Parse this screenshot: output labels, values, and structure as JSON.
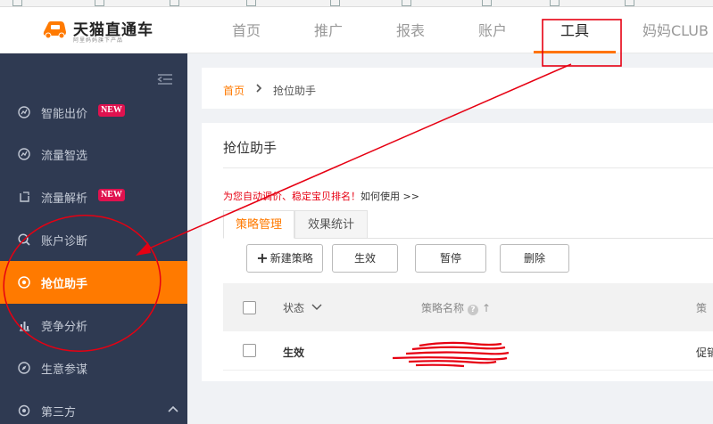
{
  "header": {
    "logo_title": "天猫直通车",
    "logo_subtitle": "阿里妈妈旗下产品",
    "nav": [
      "首页",
      "推广",
      "报表",
      "账户",
      "工具",
      "妈妈CLUB"
    ],
    "active_nav": "工具"
  },
  "sidebar": {
    "items": [
      {
        "label": "智能出价",
        "icon": "target-icon",
        "badge": "NEW"
      },
      {
        "label": "流量智选",
        "icon": "target-icon",
        "badge": ""
      },
      {
        "label": "流量解析",
        "icon": "gauge-icon",
        "badge": "NEW"
      },
      {
        "label": "账户诊断",
        "icon": "magnifier-icon",
        "badge": ""
      },
      {
        "label": "抢位助手",
        "icon": "target-icon",
        "badge": ""
      },
      {
        "label": "竞争分析",
        "icon": "bar-chart-icon",
        "badge": ""
      },
      {
        "label": "生意参谋",
        "icon": "compass-icon",
        "badge": ""
      },
      {
        "label": "第三方",
        "icon": "gear-icon",
        "badge": ""
      }
    ],
    "active_item": "抢位助手"
  },
  "breadcrumb": {
    "home": "首页",
    "current": "抢位助手"
  },
  "page": {
    "title": "抢位助手",
    "promo_red": "为您自动调价、稳定宝贝排名！",
    "promo_link": "如何使用 >>",
    "tabs": [
      "策略管理",
      "效果统计"
    ],
    "active_tab": "策略管理",
    "buttons": {
      "new": "新建策略",
      "enable": "生效",
      "pause": "暂停",
      "delete": "删除"
    },
    "table": {
      "headers": {
        "status": "状态",
        "name": "策略名称",
        "third": "策"
      },
      "rows": [
        {
          "status": "生效",
          "name": "",
          "third": "促销"
        }
      ]
    }
  },
  "colors": {
    "accent": "#ff7a00",
    "sidebar_bg": "#2f3a52",
    "badge": "#e0124f",
    "annotation": "#e60012"
  }
}
